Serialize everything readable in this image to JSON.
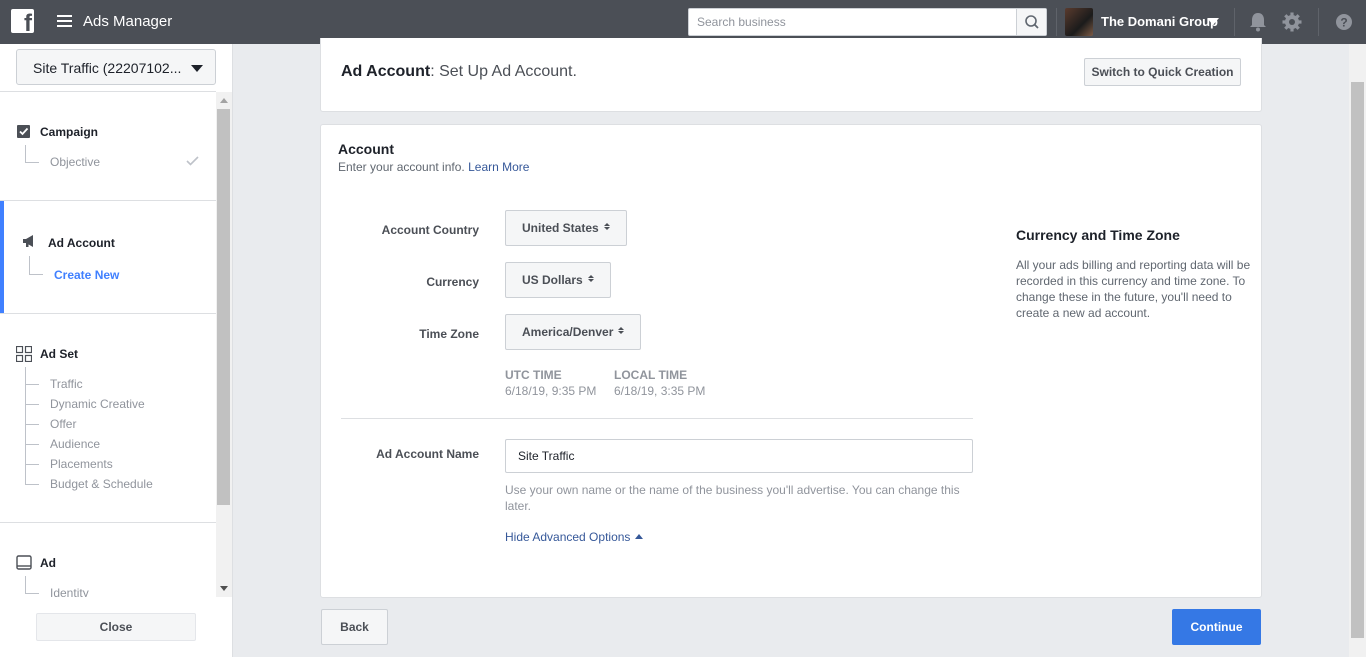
{
  "topbar": {
    "app_title": "Ads Manager",
    "search_placeholder": "Search business",
    "business_name": "The Domani Group"
  },
  "sidebar": {
    "campaign_select": "Site Traffic (22207102...",
    "sections": [
      {
        "title": "Campaign",
        "icon": "checkbox-icon",
        "items": [
          {
            "label": "Objective",
            "completed": true
          }
        ]
      },
      {
        "title": "Ad Account",
        "icon": "megaphone-icon",
        "active": true,
        "items": [
          {
            "label": "Create New",
            "active": true
          }
        ]
      },
      {
        "title": "Ad Set",
        "icon": "grid-icon",
        "items": [
          {
            "label": "Traffic"
          },
          {
            "label": "Dynamic Creative"
          },
          {
            "label": "Offer"
          },
          {
            "label": "Audience"
          },
          {
            "label": "Placements"
          },
          {
            "label": "Budget & Schedule"
          }
        ]
      },
      {
        "title": "Ad",
        "icon": "ad-frame-icon",
        "items": [
          {
            "label": "Identity"
          }
        ]
      }
    ],
    "close_label": "Close"
  },
  "header": {
    "title_bold": "Ad Account",
    "title_rest": ": Set Up Ad Account.",
    "quick_creation_label": "Switch to Quick Creation"
  },
  "account": {
    "title": "Account",
    "subtitle": "Enter your account info.",
    "learn_more": "Learn More",
    "country_label": "Account Country",
    "country_value": "United States",
    "currency_label": "Currency",
    "currency_value": "US Dollars",
    "timezone_label": "Time Zone",
    "timezone_value": "America/Denver",
    "utc_label": "UTC TIME",
    "utc_value": "6/18/19, 9:35 PM",
    "local_label": "LOCAL TIME",
    "local_value": "6/18/19, 3:35 PM",
    "name_label": "Ad Account Name",
    "name_value": "Site Traffic",
    "name_help": "Use your own name or the name of the business you'll advertise. You can change this later.",
    "advanced_link": "Hide Advanced Options"
  },
  "info": {
    "title": "Currency and Time Zone",
    "text": "All your ads billing and reporting data will be recorded in this currency and time zone. To change these in the future, you'll need to create a new ad account."
  },
  "footer": {
    "back_label": "Back",
    "continue_label": "Continue"
  },
  "colors": {
    "topbar": "#4b4f56",
    "accent": "#3578e5",
    "link": "#365899",
    "active_bar": "#4080ff"
  }
}
